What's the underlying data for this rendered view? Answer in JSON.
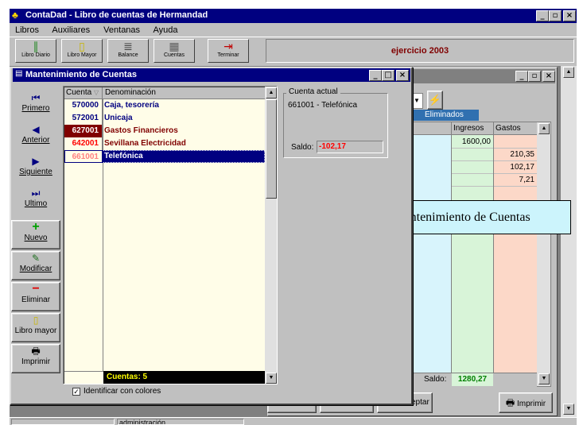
{
  "window": {
    "title": "ContaDad - Libro de cuentas de Hermandad"
  },
  "menu": {
    "items": [
      "Libros",
      "Auxiliares",
      "Ventanas",
      "Ayuda"
    ]
  },
  "toolbar": {
    "libro_diario": "Libro Diario",
    "libro_mayor": "Libro Mayor",
    "balance": "Balance",
    "cuentas": "Cuentas",
    "terminar": "Terminar",
    "ejercicio": "ejercicio 2003"
  },
  "dialog": {
    "title": "Mantenimiento de Cuentas",
    "nav": {
      "primero": "Primero",
      "anterior": "Anterior",
      "siguiente": "Siguiente",
      "ultimo": "Ultimo",
      "nuevo": "Nuevo",
      "modificar": "Modificar",
      "eliminar": "Eliminar",
      "libro_mayor": "Libro mayor",
      "imprimir": "Imprimir"
    },
    "grid": {
      "col_cuenta": "Cuenta",
      "col_denominacion": "Denominación",
      "rows": [
        {
          "cuenta": "570000",
          "denominacion": "Caja, tesorería",
          "color": "#000080",
          "cuenta_bg": "#fffde8",
          "text_color": "#000080"
        },
        {
          "cuenta": "572001",
          "denominacion": "Unicaja",
          "color": "#000080",
          "cuenta_bg": "#fffde8",
          "text_color": "#000080"
        },
        {
          "cuenta": "627001",
          "denominacion": "Gastos Financieros",
          "color": "#800000",
          "cuenta_bg": "#800000",
          "text_color": "#ff4040"
        },
        {
          "cuenta": "642001",
          "denominacion": "Sevillana Electricidad",
          "color": "#ff0000",
          "cuenta_bg": "#fffde8",
          "text_color": "#ff0000"
        },
        {
          "cuenta": "661001",
          "denominacion": "Telefónica",
          "color": "#ff0000",
          "cuenta_bg": "#fffde8",
          "text_color": "#ffffff"
        }
      ],
      "footer": "Cuentas: 5"
    },
    "cuenta_actual": {
      "label": "Cuenta actual",
      "value": "661001 - Telefónica",
      "saldo_label": "Saldo:",
      "saldo_value": "-102,17"
    },
    "identificar_colores": "Identificar con colores"
  },
  "background_window": {
    "tab_eliminados": "Eliminados",
    "col_ingresos": "Ingresos",
    "col_gastos": "Gastos",
    "ingresos": [
      "1600,00",
      "",
      "",
      "",
      ""
    ],
    "gastos": [
      "",
      "210,35",
      "102,17",
      "7,21",
      ""
    ],
    "saldo_label": "Saldo:",
    "saldo_value": "1280,27",
    "imprimir": "Imprimir",
    "aceptar_partial": "eptar"
  },
  "tooltip": {
    "text": "Mantenimiento de Cuentas"
  },
  "statusbar": {
    "user": "administración"
  }
}
